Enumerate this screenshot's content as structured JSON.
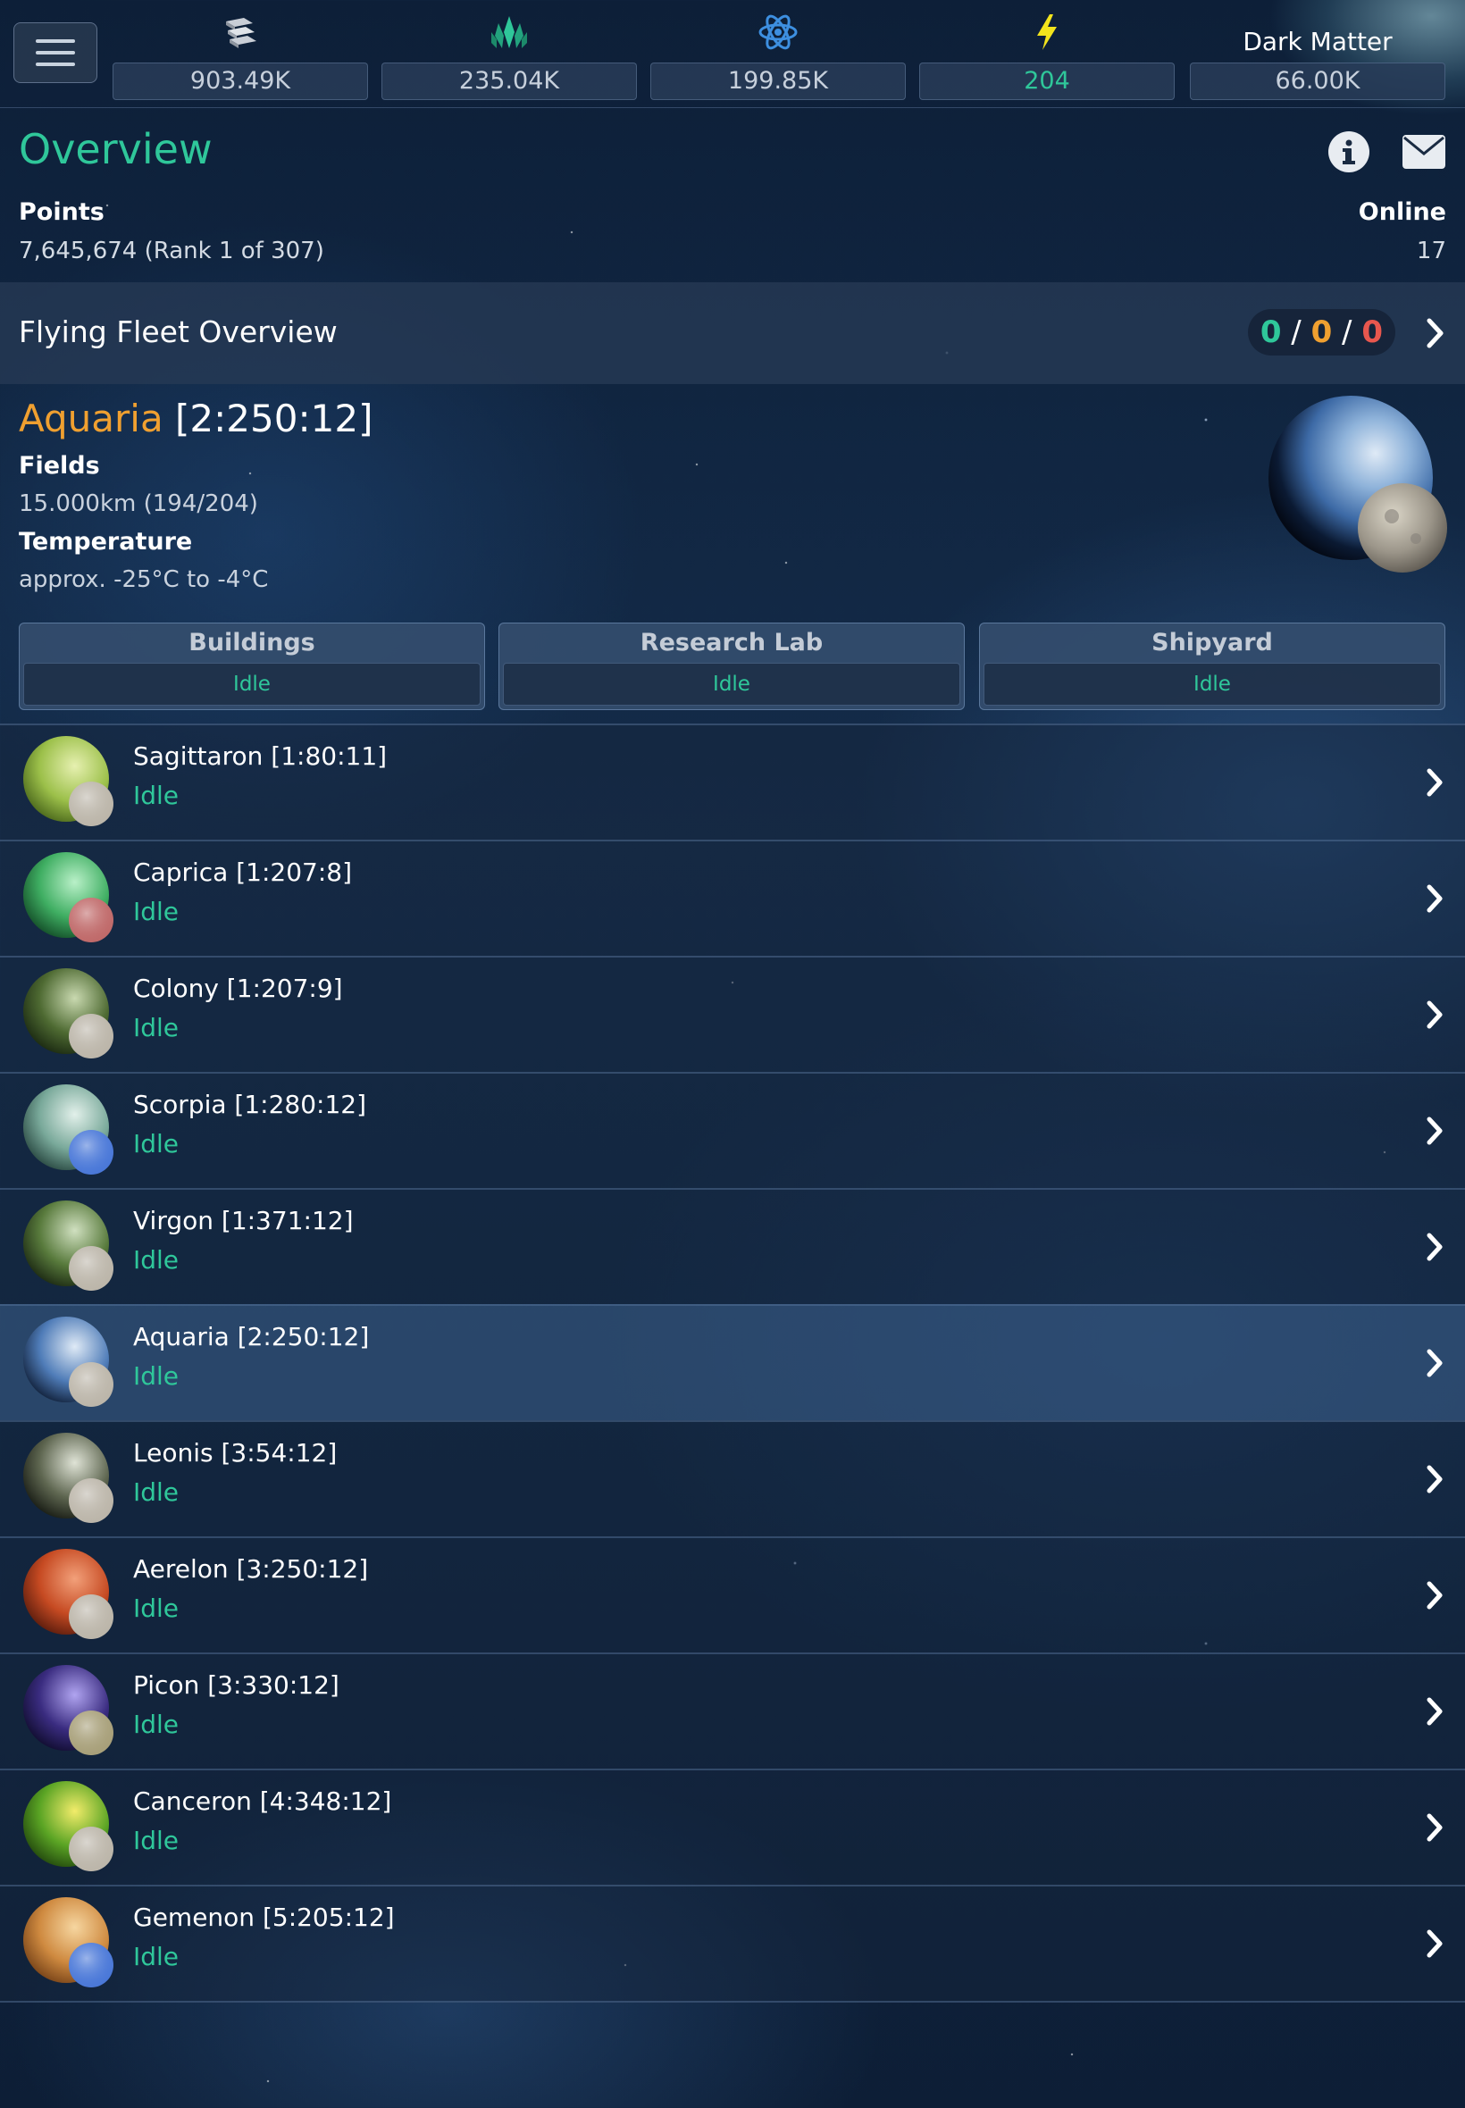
{
  "resources": [
    {
      "name": "metal",
      "icon": "metal-bars-icon",
      "value": "903.49K"
    },
    {
      "name": "crystal",
      "icon": "crystal-icon",
      "value": "235.04K"
    },
    {
      "name": "deuterium",
      "icon": "atom-icon",
      "value": "199.85K"
    },
    {
      "name": "energy",
      "icon": "lightning-icon",
      "value": "204"
    },
    {
      "name": "dark_matter",
      "label": "Dark Matter",
      "value": "66.00K"
    }
  ],
  "overview": {
    "title": "Overview",
    "points_label": "Points",
    "points_value": "7,645,674 (Rank 1 of 307)",
    "online_label": "Online",
    "online_value": "17"
  },
  "fleet": {
    "title": "Flying Fleet Overview",
    "own": "0",
    "friendly": "0",
    "hostile": "0"
  },
  "planet": {
    "name": "Aquaria",
    "coords": "[2:250:12]",
    "fields_label": "Fields",
    "fields_value": "15.000km (194/204)",
    "temperature_label": "Temperature",
    "temperature_value": "approx. -25°C to -4°C"
  },
  "queues": [
    {
      "title": "Buildings",
      "status": "Idle"
    },
    {
      "title": "Research Lab",
      "status": "Idle"
    },
    {
      "title": "Shipyard",
      "status": "Idle"
    }
  ],
  "planets": [
    {
      "name": "Sagittaron [1:80:11]",
      "status": "Idle",
      "active": false
    },
    {
      "name": "Caprica [1:207:8]",
      "status": "Idle",
      "active": false
    },
    {
      "name": "Colony [1:207:9]",
      "status": "Idle",
      "active": false
    },
    {
      "name": "Scorpia [1:280:12]",
      "status": "Idle",
      "active": false
    },
    {
      "name": "Virgon [1:371:12]",
      "status": "Idle",
      "active": false
    },
    {
      "name": "Aquaria [2:250:12]",
      "status": "Idle",
      "active": true
    },
    {
      "name": "Leonis [3:54:12]",
      "status": "Idle",
      "active": false
    },
    {
      "name": "Aerelon [3:250:12]",
      "status": "Idle",
      "active": false
    },
    {
      "name": "Picon [3:330:12]",
      "status": "Idle",
      "active": false
    },
    {
      "name": "Canceron [4:348:12]",
      "status": "Idle",
      "active": false
    },
    {
      "name": "Gemenon [5:205:12]",
      "status": "Idle",
      "active": false
    }
  ],
  "colors": {
    "accent_green": "#2fc79a",
    "accent_orange": "#f0a030",
    "accent_red": "#e8574e",
    "energy_yellow": "#f2e41c",
    "deuterium_blue": "#3d8fe0"
  }
}
